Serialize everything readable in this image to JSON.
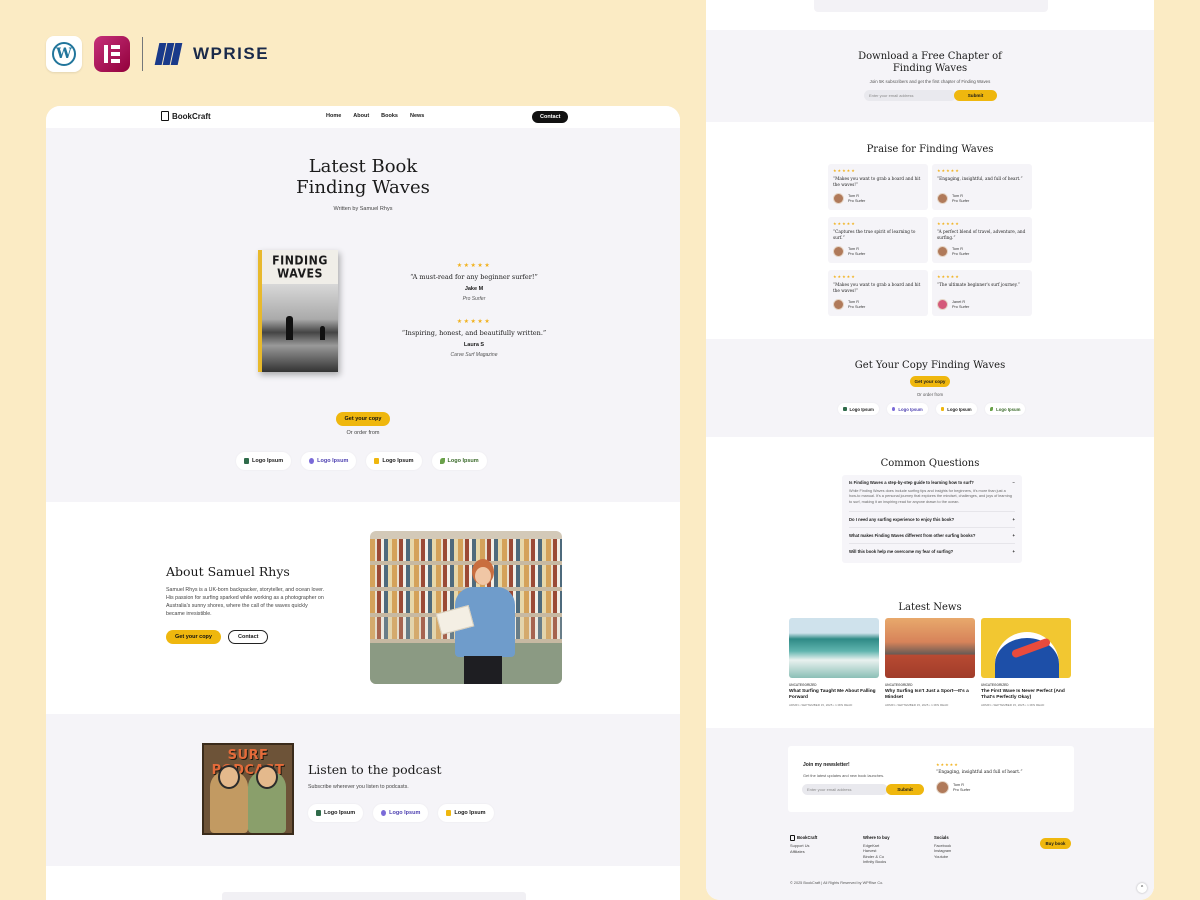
{
  "branding": {
    "wprise_label": "WPRISE",
    "wp_letter": "W"
  },
  "nav": {
    "logo": "BookCraft",
    "items": [
      "Home",
      "About",
      "Books",
      "News"
    ],
    "cta": "Contact"
  },
  "hero": {
    "title_line1": "Latest Book",
    "title_line2": "Finding Waves",
    "subtitle": "Written by Samuel Rhys",
    "book_cover_line1": "FINDING",
    "book_cover_line2": "WAVES",
    "reviews": [
      {
        "stars": "★★★★★",
        "quote": "“A must-read for any beginner surfer!”",
        "name": "Jake M",
        "role": "Pro Surfer"
      },
      {
        "stars": "★★★★★",
        "quote": "“Inspiring, honest, and beautifully written.”",
        "name": "Laura S",
        "role": "Carve Surf Magazine"
      }
    ],
    "cta": "Get your copy",
    "order_text": "Or order from",
    "logos": [
      "Logo Ipsum",
      "Logo Ipsum",
      "Logo Ipsum",
      "Logo Ipsum"
    ]
  },
  "about": {
    "title": "About Samuel Rhys",
    "body": "Samuel Rhys is a UK-born backpacker, storyteller, and ocean lover. His passion for surfing sparked while working as a photographer on Australia's sunny shores, where the call of the waves quickly became irresistible.",
    "cta_primary": "Get your copy",
    "cta_secondary": "Contact"
  },
  "podcast": {
    "art_title": "SURF PODCAST",
    "title": "Listen to the podcast",
    "subtitle": "Subscribe wherever you listen to podcasts.",
    "logos": [
      "Logo Ipsum",
      "Logo Ipsum",
      "Logo Ipsum"
    ]
  },
  "download": {
    "title_line1": "Download a Free Chapter of",
    "title_line2": "Finding Waves",
    "subtitle": "Join 5K subscribers and get the first chapter of Finding Waves",
    "input_placeholder": "Enter your email address",
    "button": "Submit"
  },
  "praise": {
    "title": "Praise for Finding Waves",
    "cards": [
      {
        "stars": "★★★★★",
        "quote": "“Makes you want to grab a board and hit the waves!”",
        "name": "Tom R",
        "role": "Pro Surfer"
      },
      {
        "stars": "★★★★★",
        "quote": "“Engaging, insightful, and full of heart.”",
        "name": "Tom R",
        "role": "Pro Surfer"
      },
      {
        "stars": "★★★★★",
        "quote": "“Captures the true spirit of learning to surf.”",
        "name": "Tom R",
        "role": "Pro Surfer"
      },
      {
        "stars": "★★★★★",
        "quote": "“A perfect blend of travel, adventure, and surfing.”",
        "name": "Tom R",
        "role": "Pro Surfer"
      },
      {
        "stars": "★★★★★",
        "quote": "“Makes you want to grab a board and hit the waves!”",
        "name": "Tom R",
        "role": "Pro Surfer"
      },
      {
        "stars": "★★★★★",
        "quote": "“The ultimate beginner's surf journey.”",
        "name": "Janet R",
        "role": "Pro Surfer"
      }
    ]
  },
  "get_copy": {
    "title": "Get Your Copy Finding Waves",
    "button": "Get your copy",
    "order_text": "Or order from",
    "logos": [
      "Logo Ipsum",
      "Logo Ipsum",
      "Logo Ipsum",
      "Logo Ipsum"
    ]
  },
  "faq": {
    "title": "Common Questions",
    "items": [
      {
        "q": "Is Finding Waves a step-by-step guide to learning how to surf?",
        "icon": "−",
        "answer": "While Finding Waves does include surfing tips and insights for beginners, it's more than just a how-to manual. It's a personal journey that explores the mindset, challenges, and joys of learning to surf, making it an inspiring read for anyone drawn to the ocean."
      },
      {
        "q": "Do I need any surfing experience to enjoy this book?",
        "icon": "+"
      },
      {
        "q": "What makes Finding Waves different from other surfing books?",
        "icon": "+"
      },
      {
        "q": "Will this book help me overcome my fear of surfing?",
        "icon": "+"
      }
    ]
  },
  "news": {
    "title": "Latest News",
    "items": [
      {
        "cat": "UNCATEGORIZED",
        "title": "What Surfing Taught Me About Falling Forward",
        "meta": "ADMIN  •  SEPTEMBER 15, 2025  •  1 MIN READ"
      },
      {
        "cat": "UNCATEGORIZED",
        "title": "Why Surfing Isn't Just a Sport—It's a Mindset",
        "meta": "ADMIN  •  SEPTEMBER 15, 2025  •  1 MIN READ"
      },
      {
        "cat": "UNCATEGORIZED",
        "title": "The First Wave Is Never Perfect (And That's Perfectly Okay)",
        "meta": "ADMIN  •  SEPTEMBER 15, 2025  •  1 MIN READ"
      }
    ]
  },
  "newsletter": {
    "title": "Join my newsletter!",
    "subtitle": "Get the latest updates and new book launches.",
    "input_placeholder": "Enter your email address",
    "button": "Submit",
    "stars": "★★★★★",
    "quote": "“Engaging, insightful and full of heart.”",
    "name": "Tom R",
    "role": "Pro Surfer"
  },
  "footer": {
    "logo": "BookCraft",
    "links1": [
      "Support Us",
      "Affiliates"
    ],
    "where_title": "Where to buy",
    "where": [
      "EdgeKart",
      "Harvest",
      "Binder & Co",
      "Infinity Books"
    ],
    "socials_title": "Socials",
    "socials": [
      "Facebook",
      "Instagram",
      "Youtube"
    ],
    "cta": "Buy book",
    "copyright": "© 2025 BookCraft  |  All Rights Reserved by  WPRise Co.",
    "up_icon": "^"
  }
}
